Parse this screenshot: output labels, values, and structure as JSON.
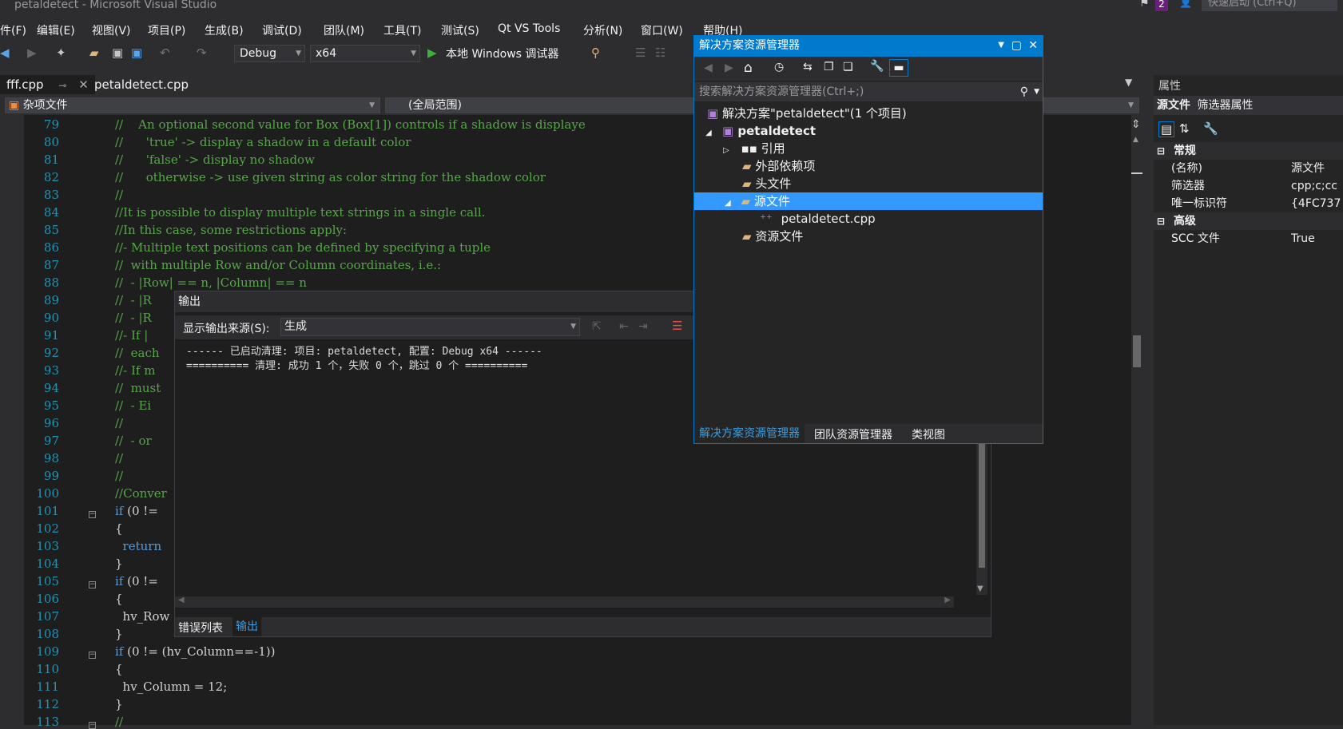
{
  "window": {
    "title": "petaldetect - Microsoft Visual Studio",
    "notification_count": "2",
    "quick_launch_placeholder": "快速启动 (Ctrl+Q)"
  },
  "menu": [
    "件(F)",
    "编辑(E)",
    "视图(V)",
    "项目(P)",
    "生成(B)",
    "调试(D)",
    "团队(M)",
    "工具(T)",
    "测试(S)",
    "Qt VS Tools",
    "分析(N)",
    "窗口(W)",
    "帮助(H)"
  ],
  "toolbar": {
    "config": "Debug",
    "platform": "x64",
    "run_label": "本地 Windows 调试器"
  },
  "doc_tabs": [
    {
      "label": "fff.cpp"
    },
    {
      "label": "petaldetect.cpp"
    }
  ],
  "navbar": {
    "project": "杂项文件",
    "scope": "(全局范围)"
  },
  "editor": {
    "lines": [
      {
        "n": "79",
        "t": "//    An optional second value for Box (Box[1]) controls if a shadow is displaye",
        "c": "cm"
      },
      {
        "n": "80",
        "t": "//      'true' -> display a shadow in a default color",
        "c": "cm"
      },
      {
        "n": "81",
        "t": "//      'false' -> display no shadow",
        "c": "cm"
      },
      {
        "n": "82",
        "t": "//      otherwise -> use given string as color string for the shadow color",
        "c": "cm"
      },
      {
        "n": "83",
        "t": "//",
        "c": "cm"
      },
      {
        "n": "84",
        "t": "//It is possible to display multiple text strings in a single call.",
        "c": "cm"
      },
      {
        "n": "85",
        "t": "//In this case, some restrictions apply:",
        "c": "cm"
      },
      {
        "n": "86",
        "t": "//- Multiple text positions can be defined by specifying a tuple",
        "c": "cm"
      },
      {
        "n": "87",
        "t": "//  with multiple Row and/or Column coordinates, i.e.:",
        "c": "cm"
      },
      {
        "n": "88",
        "t": "//  - |Row| == n, |Column| == n",
        "c": "cm"
      },
      {
        "n": "89",
        "t": "//  - |R",
        "c": "cm"
      },
      {
        "n": "90",
        "t": "//  - |R",
        "c": "cm"
      },
      {
        "n": "91",
        "t": "//- If |",
        "c": "cm"
      },
      {
        "n": "92",
        "t": "//  each",
        "c": "cm"
      },
      {
        "n": "93",
        "t": "//- If m",
        "c": "cm"
      },
      {
        "n": "94",
        "t": "//  must",
        "c": "cm"
      },
      {
        "n": "95",
        "t": "//  - Ei",
        "c": "cm"
      },
      {
        "n": "96",
        "t": "//",
        "c": "cm"
      },
      {
        "n": "97",
        "t": "//  - or",
        "c": "cm"
      },
      {
        "n": "98",
        "t": "//",
        "c": "cm"
      },
      {
        "n": "99",
        "t": "//",
        "c": "cm"
      },
      {
        "n": "100",
        "t": "//Conver",
        "c": "cm"
      },
      {
        "n": "101",
        "t": "if (0 !=",
        "c": "kw"
      },
      {
        "n": "102",
        "t": "{",
        "c": ""
      },
      {
        "n": "103",
        "t": "  return",
        "c": "kw"
      },
      {
        "n": "104",
        "t": "}",
        "c": ""
      },
      {
        "n": "105",
        "t": "if (0 !=",
        "c": "kw"
      },
      {
        "n": "106",
        "t": "{",
        "c": ""
      },
      {
        "n": "107",
        "t": "  hv_Row",
        "c": ""
      },
      {
        "n": "108",
        "t": "}",
        "c": ""
      },
      {
        "n": "109",
        "t": "if (0 != (hv_Column==-1))",
        "c": "kw"
      },
      {
        "n": "110",
        "t": "{",
        "c": ""
      },
      {
        "n": "111",
        "t": "  hv_Column = 12;",
        "c": ""
      },
      {
        "n": "112",
        "t": "}",
        "c": ""
      },
      {
        "n": "113",
        "t": "//",
        "c": "cm"
      }
    ]
  },
  "output": {
    "title": "输出",
    "source_label": "显示输出来源(S):",
    "source_value": "生成",
    "text": [
      "------ 已启动清理: 项目: petaldetect, 配置: Debug x64 ------",
      "========== 清理: 成功 1 个，失败 0 个，跳过 0 个 =========="
    ],
    "tabs": [
      "错误列表",
      "输出"
    ]
  },
  "solution_explorer": {
    "title": "解决方案资源管理器",
    "search_placeholder": "搜索解决方案资源管理器(Ctrl+;)",
    "solution": "解决方案\"petaldetect\"(1 个项目)",
    "project": "petaldetect",
    "items": [
      "引用",
      "外部依赖项",
      "头文件",
      "源文件",
      "petaldetect.cpp",
      "资源文件"
    ],
    "tabs": [
      "解决方案资源管理器",
      "团队资源管理器",
      "类视图"
    ]
  },
  "properties": {
    "title": "属性",
    "object": "源文件",
    "object_type": "筛选器属性",
    "cat_general": "常规",
    "cat_advanced": "高级",
    "rows": [
      {
        "k": "(名称)",
        "v": "源文件"
      },
      {
        "k": "筛选器",
        "v": "cpp;c;cc"
      },
      {
        "k": "唯一标识符",
        "v": "{4FC737"
      }
    ],
    "adv_rows": [
      {
        "k": "SCC 文件",
        "v": "True"
      }
    ]
  }
}
